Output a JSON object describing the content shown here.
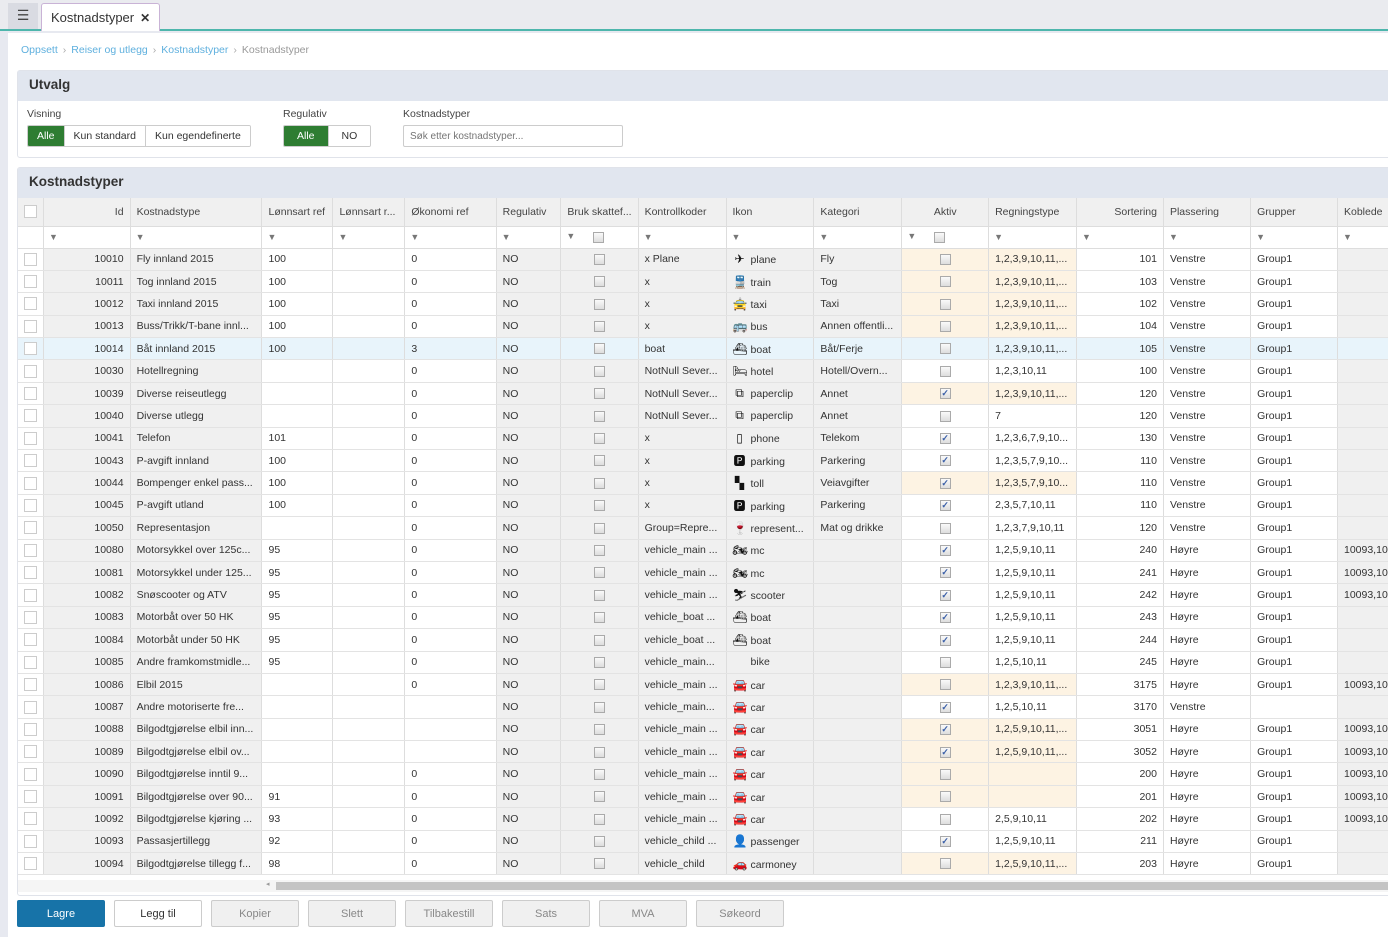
{
  "tab": {
    "title": "Kostnadstyper",
    "close": "✕"
  },
  "breadcrumb": [
    "Oppsett",
    "Reiser og utlegg",
    "Kostnadstyper",
    "Kostnadstyper"
  ],
  "utvalg": {
    "title": "Utvalg",
    "visning": {
      "label": "Visning",
      "options": [
        "Alle",
        "Kun standard",
        "Kun egendefinerte"
      ],
      "selected": "Alle"
    },
    "regulativ": {
      "label": "Regulativ",
      "options": [
        "Alle",
        "NO"
      ],
      "selected": "Alle"
    },
    "search": {
      "label": "Kostnadstyper",
      "placeholder": "Søk etter kostnadstyper...",
      "value": ""
    }
  },
  "grid": {
    "title": "Kostnadstyper",
    "columns": [
      "Id",
      "Kostnadstype",
      "Lønnsart ref",
      "Lønnsart r...",
      "Økonomi ref",
      "Regulativ",
      "Bruk skattef...",
      "Kontrollkoder",
      "Ikon",
      "Kategori",
      "Aktiv",
      "Regningstype",
      "Sortering",
      "Plassering",
      "Grupper",
      "Koblede"
    ],
    "rows": [
      {
        "id": "10010",
        "name": "Fly innland 2015",
        "lref": "100",
        "lref2": "",
        "oref": "0",
        "reg": "NO",
        "bruk": false,
        "kk": "x Plane",
        "icon": "plane",
        "iconName": "plane",
        "kat": "Fly",
        "aktiv": false,
        "regn": "1,2,3,9,10,11,...",
        "sort": "101",
        "plass": "Venstre",
        "grp": "Group1",
        "kob": "",
        "hl": true
      },
      {
        "id": "10011",
        "name": "Tog innland 2015",
        "lref": "100",
        "lref2": "",
        "oref": "0",
        "reg": "NO",
        "bruk": false,
        "kk": "x",
        "icon": "train",
        "iconName": "train",
        "kat": "Tog",
        "aktiv": false,
        "regn": "1,2,3,9,10,11,...",
        "sort": "103",
        "plass": "Venstre",
        "grp": "Group1",
        "kob": "",
        "hl": true
      },
      {
        "id": "10012",
        "name": "Taxi innland 2015",
        "lref": "100",
        "lref2": "",
        "oref": "0",
        "reg": "NO",
        "bruk": false,
        "kk": "x",
        "icon": "taxi",
        "iconName": "taxi",
        "kat": "Taxi",
        "aktiv": false,
        "regn": "1,2,3,9,10,11,...",
        "sort": "102",
        "plass": "Venstre",
        "grp": "Group1",
        "kob": "",
        "hl": true
      },
      {
        "id": "10013",
        "name": "Buss/Trikk/T-bane innl...",
        "lref": "100",
        "lref2": "",
        "oref": "0",
        "reg": "NO",
        "bruk": false,
        "kk": "x",
        "icon": "bus",
        "iconName": "bus",
        "kat": "Annen offentli...",
        "aktiv": false,
        "regn": "1,2,3,9,10,11,...",
        "sort": "104",
        "plass": "Venstre",
        "grp": "Group1",
        "kob": "",
        "hl": true
      },
      {
        "id": "10014",
        "name": "Båt innland 2015",
        "lref": "100",
        "lref2": "",
        "oref": "3",
        "reg": "NO",
        "bruk": false,
        "kk": "boat",
        "icon": "boat",
        "iconName": "boat",
        "kat": "Båt/Ferje",
        "aktiv": false,
        "regn": "1,2,3,9,10,11,...",
        "sort": "105",
        "plass": "Venstre",
        "grp": "Group1",
        "kob": "",
        "hl": false,
        "selected": true
      },
      {
        "id": "10030",
        "name": "Hotellregning",
        "lref": "",
        "lref2": "",
        "oref": "0",
        "reg": "NO",
        "bruk": false,
        "kk": "NotNull Sever...",
        "icon": "hotel",
        "iconName": "hotel",
        "kat": "Hotell/Overn...",
        "aktiv": false,
        "regn": "1,2,3,10,11",
        "sort": "100",
        "plass": "Venstre",
        "grp": "Group1",
        "kob": "",
        "hl": false
      },
      {
        "id": "10039",
        "name": "Diverse reiseutlegg",
        "lref": "",
        "lref2": "",
        "oref": "0",
        "reg": "NO",
        "bruk": false,
        "kk": "NotNull Sever...",
        "icon": "paperclip",
        "iconName": "paperclip",
        "kat": "Annet",
        "aktiv": true,
        "regn": "1,2,3,9,10,11,...",
        "sort": "120",
        "plass": "Venstre",
        "grp": "Group1",
        "kob": "",
        "hl": true
      },
      {
        "id": "10040",
        "name": "Diverse utlegg",
        "lref": "",
        "lref2": "",
        "oref": "0",
        "reg": "NO",
        "bruk": false,
        "kk": "NotNull Sever...",
        "icon": "paperclip",
        "iconName": "paperclip",
        "kat": "Annet",
        "aktiv": false,
        "regn": "7",
        "sort": "120",
        "plass": "Venstre",
        "grp": "Group1",
        "kob": "",
        "hl": false
      },
      {
        "id": "10041",
        "name": "Telefon",
        "lref": "101",
        "lref2": "",
        "oref": "0",
        "reg": "NO",
        "bruk": false,
        "kk": "x",
        "icon": "phone",
        "iconName": "phone",
        "kat": "Telekom",
        "aktiv": true,
        "regn": "1,2,3,6,7,9,10...",
        "sort": "130",
        "plass": "Venstre",
        "grp": "Group1",
        "kob": "",
        "hl": false
      },
      {
        "id": "10043",
        "name": "P-avgift innland",
        "lref": "100",
        "lref2": "",
        "oref": "0",
        "reg": "NO",
        "bruk": false,
        "kk": "x",
        "icon": "parking",
        "iconName": "parking",
        "kat": "Parkering",
        "aktiv": true,
        "regn": "1,2,3,5,7,9,10...",
        "sort": "110",
        "plass": "Venstre",
        "grp": "Group1",
        "kob": "",
        "hl": false
      },
      {
        "id": "10044",
        "name": "Bompenger enkel pass...",
        "lref": "100",
        "lref2": "",
        "oref": "0",
        "reg": "NO",
        "bruk": false,
        "kk": "x",
        "icon": "toll",
        "iconName": "toll",
        "kat": "Veiavgifter",
        "aktiv": true,
        "regn": "1,2,3,5,7,9,10...",
        "sort": "110",
        "plass": "Venstre",
        "grp": "Group1",
        "kob": "",
        "hl": true
      },
      {
        "id": "10045",
        "name": "P-avgift utland",
        "lref": "100",
        "lref2": "",
        "oref": "0",
        "reg": "NO",
        "bruk": false,
        "kk": "x",
        "icon": "parking",
        "iconName": "parking",
        "kat": "Parkering",
        "aktiv": true,
        "regn": "2,3,5,7,10,11",
        "sort": "110",
        "plass": "Venstre",
        "grp": "Group1",
        "kob": "",
        "hl": false
      },
      {
        "id": "10050",
        "name": "Representasjon",
        "lref": "",
        "lref2": "",
        "oref": "0",
        "reg": "NO",
        "bruk": false,
        "kk": "Group=Repre...",
        "icon": "represent",
        "iconName": "represent...",
        "kat": "Mat og drikke",
        "aktiv": false,
        "regn": "1,2,3,7,9,10,11",
        "sort": "120",
        "plass": "Venstre",
        "grp": "Group1",
        "kob": "",
        "hl": false
      },
      {
        "id": "10080",
        "name": "Motorsykkel over 125c...",
        "lref": "95",
        "lref2": "",
        "oref": "0",
        "reg": "NO",
        "bruk": false,
        "kk": "vehicle_main ...",
        "icon": "mc",
        "iconName": "mc",
        "kat": "",
        "aktiv": true,
        "regn": "1,2,5,9,10,11",
        "sort": "240",
        "plass": "Høyre",
        "grp": "Group1",
        "kob": "10093,10",
        "hl": false
      },
      {
        "id": "10081",
        "name": "Motorsykkel under 125...",
        "lref": "95",
        "lref2": "",
        "oref": "0",
        "reg": "NO",
        "bruk": false,
        "kk": "vehicle_main ...",
        "icon": "mc",
        "iconName": "mc",
        "kat": "",
        "aktiv": true,
        "regn": "1,2,5,9,10,11",
        "sort": "241",
        "plass": "Høyre",
        "grp": "Group1",
        "kob": "10093,10",
        "hl": false
      },
      {
        "id": "10082",
        "name": "Snøscooter og ATV",
        "lref": "95",
        "lref2": "",
        "oref": "0",
        "reg": "NO",
        "bruk": false,
        "kk": "vehicle_main ...",
        "icon": "scooter",
        "iconName": "scooter",
        "kat": "",
        "aktiv": true,
        "regn": "1,2,5,9,10,11",
        "sort": "242",
        "plass": "Høyre",
        "grp": "Group1",
        "kob": "10093,10",
        "hl": false
      },
      {
        "id": "10083",
        "name": "Motorbåt over 50 HK",
        "lref": "95",
        "lref2": "",
        "oref": "0",
        "reg": "NO",
        "bruk": false,
        "kk": "vehicle_boat ...",
        "icon": "boat",
        "iconName": "boat",
        "kat": "",
        "aktiv": true,
        "regn": "1,2,5,9,10,11",
        "sort": "243",
        "plass": "Høyre",
        "grp": "Group1",
        "kob": "",
        "hl": false
      },
      {
        "id": "10084",
        "name": "Motorbåt under 50 HK",
        "lref": "95",
        "lref2": "",
        "oref": "0",
        "reg": "NO",
        "bruk": false,
        "kk": "vehicle_boat ...",
        "icon": "boat",
        "iconName": "boat",
        "kat": "",
        "aktiv": true,
        "regn": "1,2,5,9,10,11",
        "sort": "244",
        "plass": "Høyre",
        "grp": "Group1",
        "kob": "",
        "hl": false
      },
      {
        "id": "10085",
        "name": "Andre framkomstmidle...",
        "lref": "95",
        "lref2": "",
        "oref": "0",
        "reg": "NO",
        "bruk": false,
        "kk": "vehicle_main...",
        "icon": "bike",
        "iconName": "bike",
        "kat": "",
        "aktiv": false,
        "regn": "1,2,5,10,11",
        "sort": "245",
        "plass": "Høyre",
        "grp": "Group1",
        "kob": "",
        "hl": false
      },
      {
        "id": "10086",
        "name": "Elbil 2015",
        "lref": "",
        "lref2": "",
        "oref": "0",
        "reg": "NO",
        "bruk": false,
        "kk": "vehicle_main ...",
        "icon": "car",
        "iconName": "car",
        "kat": "",
        "aktiv": false,
        "regn": "1,2,3,9,10,11,...",
        "sort": "3175",
        "plass": "Høyre",
        "grp": "Group1",
        "kob": "10093,10",
        "hl": true
      },
      {
        "id": "10087",
        "name": "Andre motoriserte fre...",
        "lref": "",
        "lref2": "",
        "oref": "",
        "reg": "NO",
        "bruk": false,
        "kk": "vehicle_main...",
        "icon": "car",
        "iconName": "car",
        "kat": "",
        "aktiv": true,
        "regn": "1,2,5,10,11",
        "sort": "3170",
        "plass": "Venstre",
        "grp": "",
        "kob": "",
        "hl": false
      },
      {
        "id": "10088",
        "name": "Bilgodtgjørelse elbil inn...",
        "lref": "",
        "lref2": "",
        "oref": "",
        "reg": "NO",
        "bruk": false,
        "kk": "vehicle_main ...",
        "icon": "car",
        "iconName": "car",
        "kat": "",
        "aktiv": true,
        "regn": "1,2,5,9,10,11,...",
        "sort": "3051",
        "plass": "Høyre",
        "grp": "Group1",
        "kob": "10093,10",
        "hl": true
      },
      {
        "id": "10089",
        "name": "Bilgodtgjørelse elbil ov...",
        "lref": "",
        "lref2": "",
        "oref": "",
        "reg": "NO",
        "bruk": false,
        "kk": "vehicle_main ...",
        "icon": "car",
        "iconName": "car",
        "kat": "",
        "aktiv": true,
        "regn": "1,2,5,9,10,11,...",
        "sort": "3052",
        "plass": "Høyre",
        "grp": "Group1",
        "kob": "10093,10",
        "hl": true
      },
      {
        "id": "10090",
        "name": "Bilgodtgjørelse inntil 9...",
        "lref": "",
        "lref2": "",
        "oref": "0",
        "reg": "NO",
        "bruk": false,
        "kk": "vehicle_main ...",
        "icon": "car",
        "iconName": "car",
        "kat": "",
        "aktiv": false,
        "regn": "",
        "sort": "200",
        "plass": "Høyre",
        "grp": "Group1",
        "kob": "10093,10",
        "hl": true
      },
      {
        "id": "10091",
        "name": "Bilgodtgjørelse over 90...",
        "lref": "91",
        "lref2": "",
        "oref": "0",
        "reg": "NO",
        "bruk": false,
        "kk": "vehicle_main ...",
        "icon": "car",
        "iconName": "car",
        "kat": "",
        "aktiv": false,
        "regn": "",
        "sort": "201",
        "plass": "Høyre",
        "grp": "Group1",
        "kob": "10093,10",
        "hl": true
      },
      {
        "id": "10092",
        "name": "Bilgodtgjørelse kjøring ...",
        "lref": "93",
        "lref2": "",
        "oref": "0",
        "reg": "NO",
        "bruk": false,
        "kk": "vehicle_main ...",
        "icon": "car",
        "iconName": "car",
        "kat": "",
        "aktiv": false,
        "regn": "2,5,9,10,11",
        "sort": "202",
        "plass": "Høyre",
        "grp": "Group1",
        "kob": "10093,10",
        "hl": false
      },
      {
        "id": "10093",
        "name": "Passasjertillegg",
        "lref": "92",
        "lref2": "",
        "oref": "0",
        "reg": "NO",
        "bruk": false,
        "kk": "vehicle_child ...",
        "icon": "passenger",
        "iconName": "passenger",
        "kat": "",
        "aktiv": true,
        "regn": "1,2,5,9,10,11",
        "sort": "211",
        "plass": "Høyre",
        "grp": "Group1",
        "kob": "",
        "hl": false
      },
      {
        "id": "10094",
        "name": "Bilgodtgjørelse tillegg f...",
        "lref": "98",
        "lref2": "",
        "oref": "0",
        "reg": "NO",
        "bruk": false,
        "kk": "vehicle_child",
        "icon": "carmoney",
        "iconName": "carmoney",
        "kat": "",
        "aktiv": false,
        "regn": "1,2,5,9,10,11,...",
        "sort": "203",
        "plass": "Høyre",
        "grp": "Group1",
        "kob": "",
        "hl": true
      }
    ]
  },
  "icons": {
    "plane": "✈",
    "train": "🚆",
    "taxi": "🚖",
    "bus": "🚌",
    "boat": "⛴",
    "hotel": "🛏",
    "paperclip": "⧉",
    "phone": "▯",
    "parking": "🅿",
    "toll": "▚",
    "represent": "🍷",
    "mc": "🏍",
    "scooter": "⛷",
    "bike": "",
    "car": "🚘",
    "passenger": "👤",
    "carmoney": "🚗"
  },
  "buttons": [
    "Lagre",
    "Legg til",
    "Kopier",
    "Slett",
    "Tilbakestill",
    "Sats",
    "MVA",
    "Søkeord"
  ],
  "colors": {
    "accent": "#2e7d32",
    "primary": "#1773a8",
    "highlight": "#fdf3e3",
    "selected_row": "#e8f4fb",
    "link": "#5fb0de",
    "tab_underline": "#4db6ac"
  }
}
